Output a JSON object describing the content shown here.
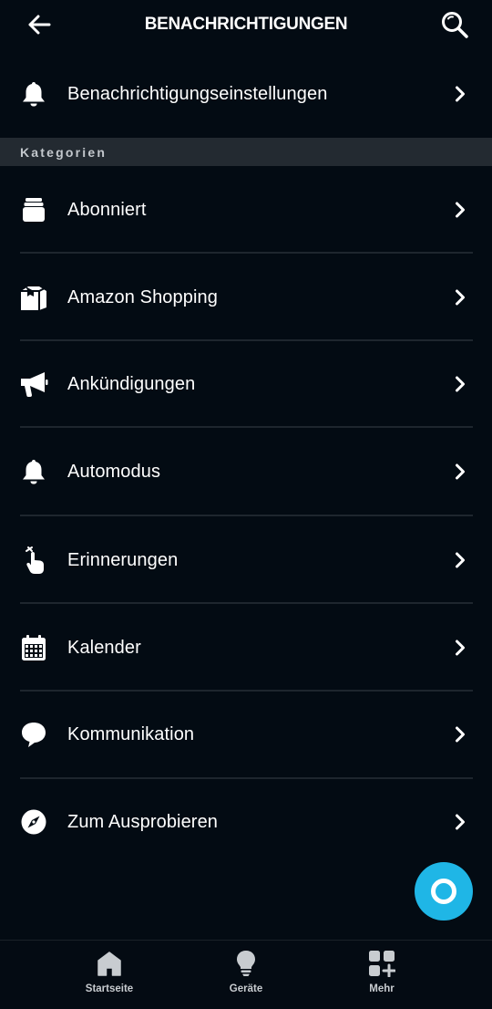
{
  "header": {
    "title": "BENACHRICHTIGUNGEN",
    "back_icon": "arrow-left-icon",
    "search_icon": "magnifier-icon"
  },
  "settings_row": {
    "label": "Benachrichtigungseinstellungen",
    "icon": "bell-icon"
  },
  "section": {
    "label": "Kategorien"
  },
  "categories": [
    {
      "label": "Abonniert",
      "icon": "subscription-stack-icon"
    },
    {
      "label": "Amazon Shopping",
      "icon": "package-icon"
    },
    {
      "label": "Ankündigungen",
      "icon": "megaphone-icon"
    },
    {
      "label": "Automodus",
      "icon": "bell-icon"
    },
    {
      "label": "Erinnerungen",
      "icon": "finger-tap-icon"
    },
    {
      "label": "Kalender",
      "icon": "calendar-icon"
    },
    {
      "label": "Kommunikation",
      "icon": "chat-bubble-icon"
    },
    {
      "label": "Zum Ausprobieren",
      "icon": "compass-icon"
    }
  ],
  "fab": {
    "icon": "alexa-ring-icon",
    "color": "#1fb6e6"
  },
  "bottom_nav": [
    {
      "label": "Startseite",
      "icon": "home-icon"
    },
    {
      "label": "Geräte",
      "icon": "lightbulb-icon"
    },
    {
      "label": "Mehr",
      "icon": "grid-plus-icon"
    }
  ],
  "colors": {
    "background": "#030b13",
    "section_bar": "#232a31",
    "divider": "#1e262e",
    "text": "#ffffff"
  }
}
